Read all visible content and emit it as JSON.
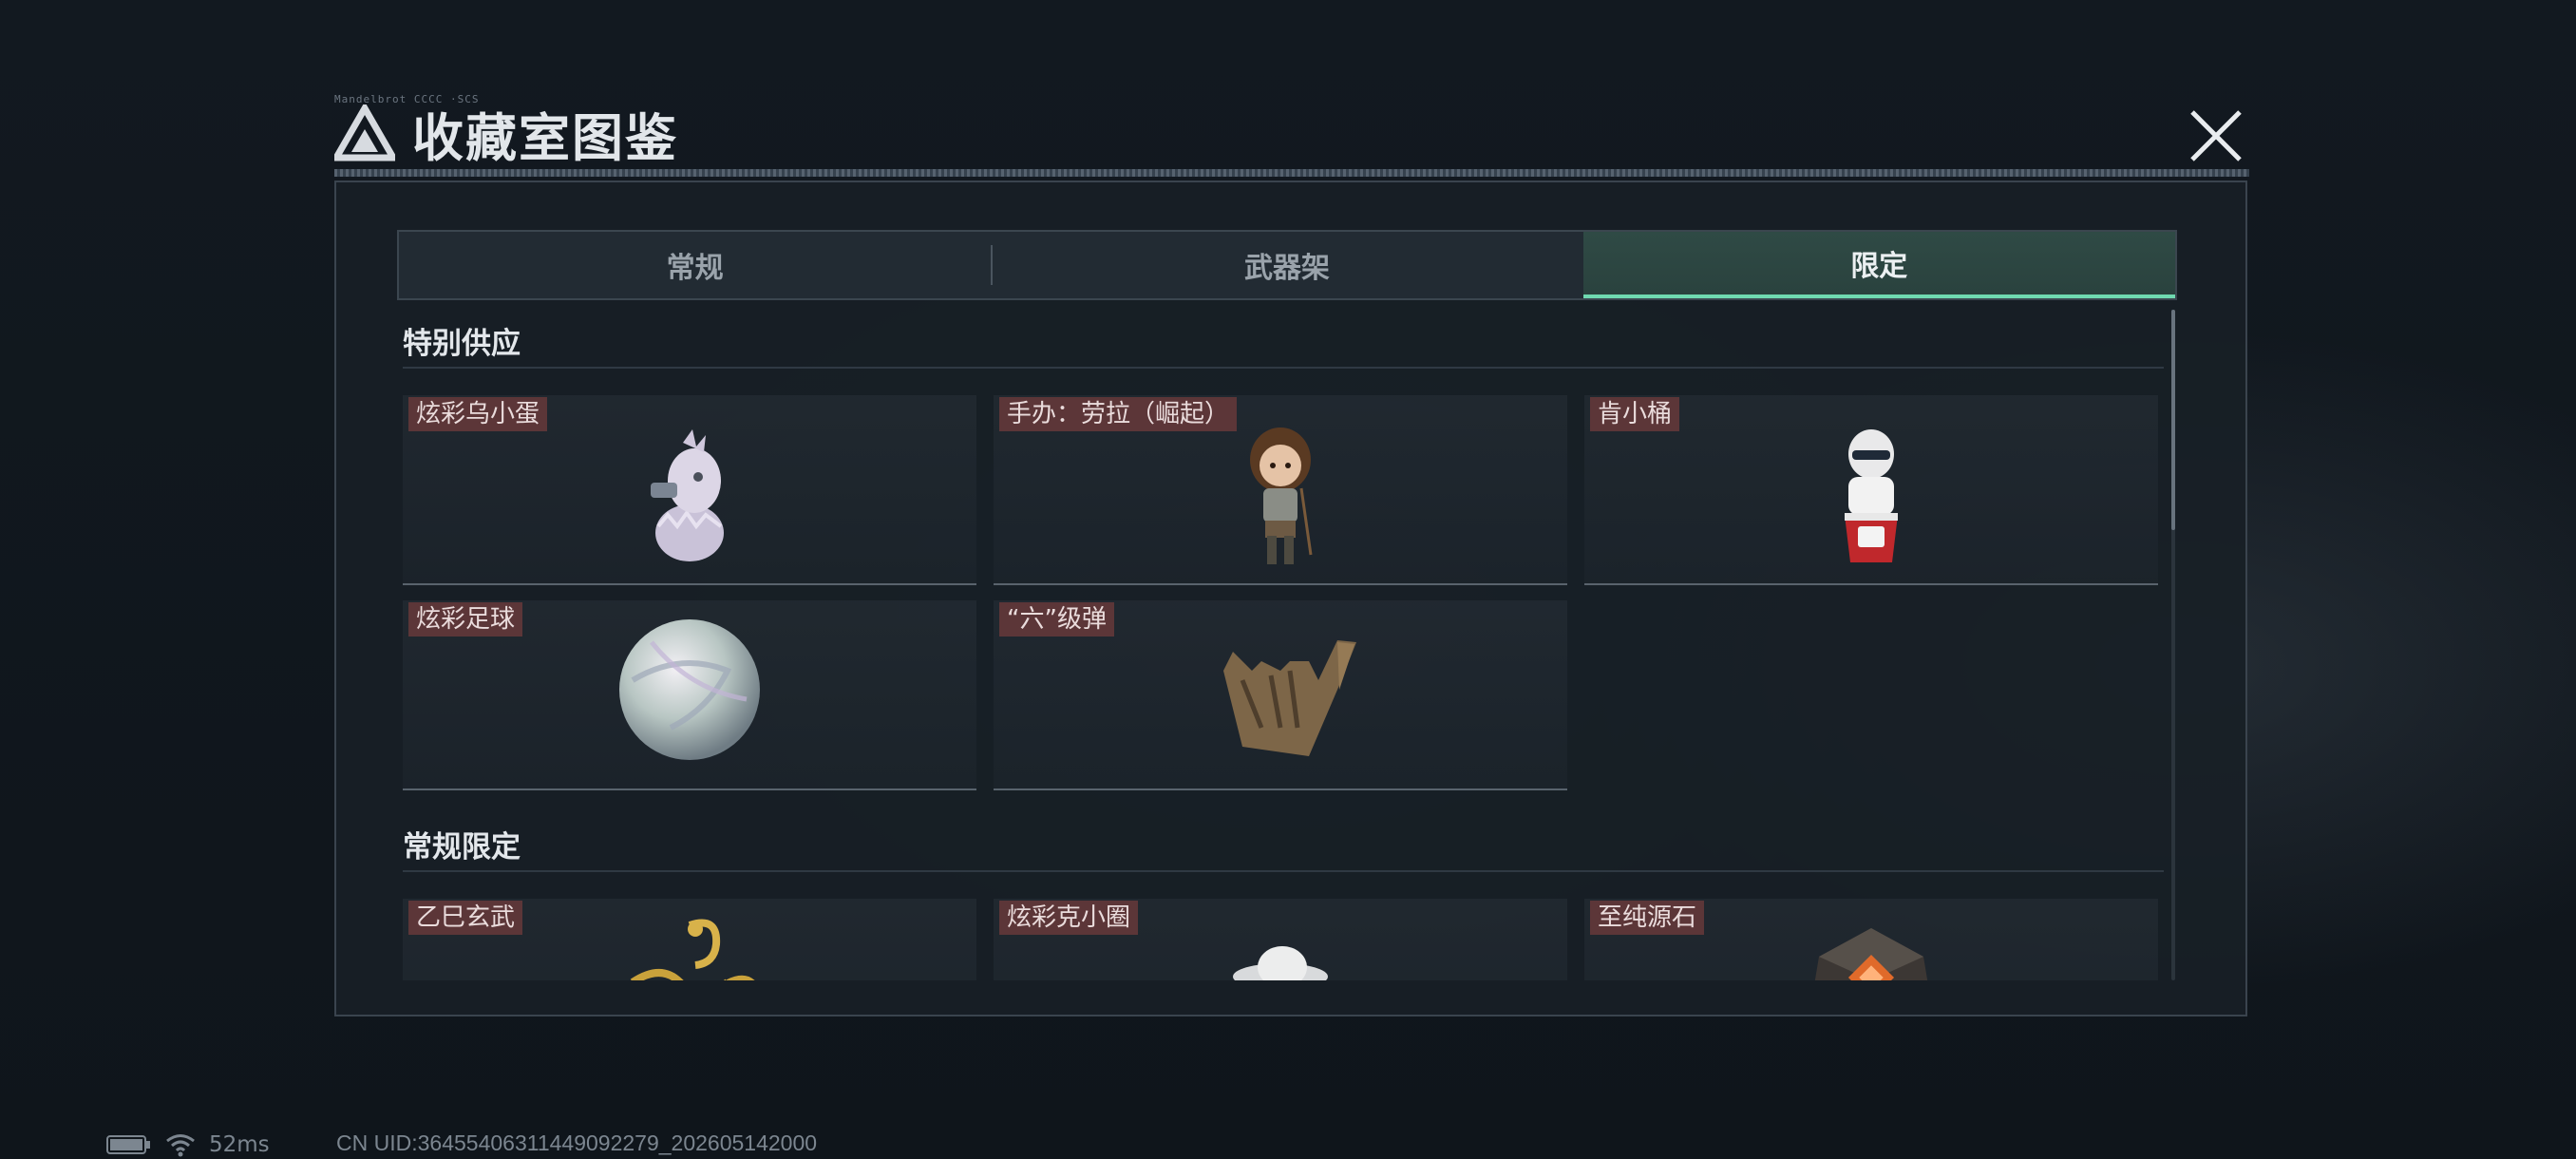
{
  "header": {
    "title": "收藏室图鉴",
    "tiny_caption": "Mandelbrot  CCCC  ·SCS"
  },
  "tabs": [
    {
      "label": "常规",
      "active": false
    },
    {
      "label": "武器架",
      "active": false
    },
    {
      "label": "限定",
      "active": true
    }
  ],
  "sections": [
    {
      "title": "特别供应",
      "items": [
        {
          "label": "炫彩乌小蛋",
          "icon": "baby-bird-egg-figure"
        },
        {
          "label": "手办：劳拉（崛起）",
          "icon": "lara-croft-figure"
        },
        {
          "label": "肯小桶",
          "icon": "colonel-bucket-figure"
        },
        {
          "label": "炫彩足球",
          "icon": "iridescent-soccer-ball"
        },
        {
          "label": "“六”级弹",
          "icon": "bronze-hand-sign"
        }
      ]
    },
    {
      "title": "常规限定",
      "items": [
        {
          "label": "乙巳玄武",
          "icon": "golden-snake"
        },
        {
          "label": "炫彩克小圈",
          "icon": "white-hat-figure"
        },
        {
          "label": "至纯源石",
          "icon": "orange-crystal-stone"
        }
      ]
    }
  ],
  "status": {
    "latency": "52ms",
    "uid": "CN UID:36455406311449092279_202605142000"
  },
  "colors": {
    "accent": "#6fd9b0",
    "label_bg": "#5c3638"
  }
}
